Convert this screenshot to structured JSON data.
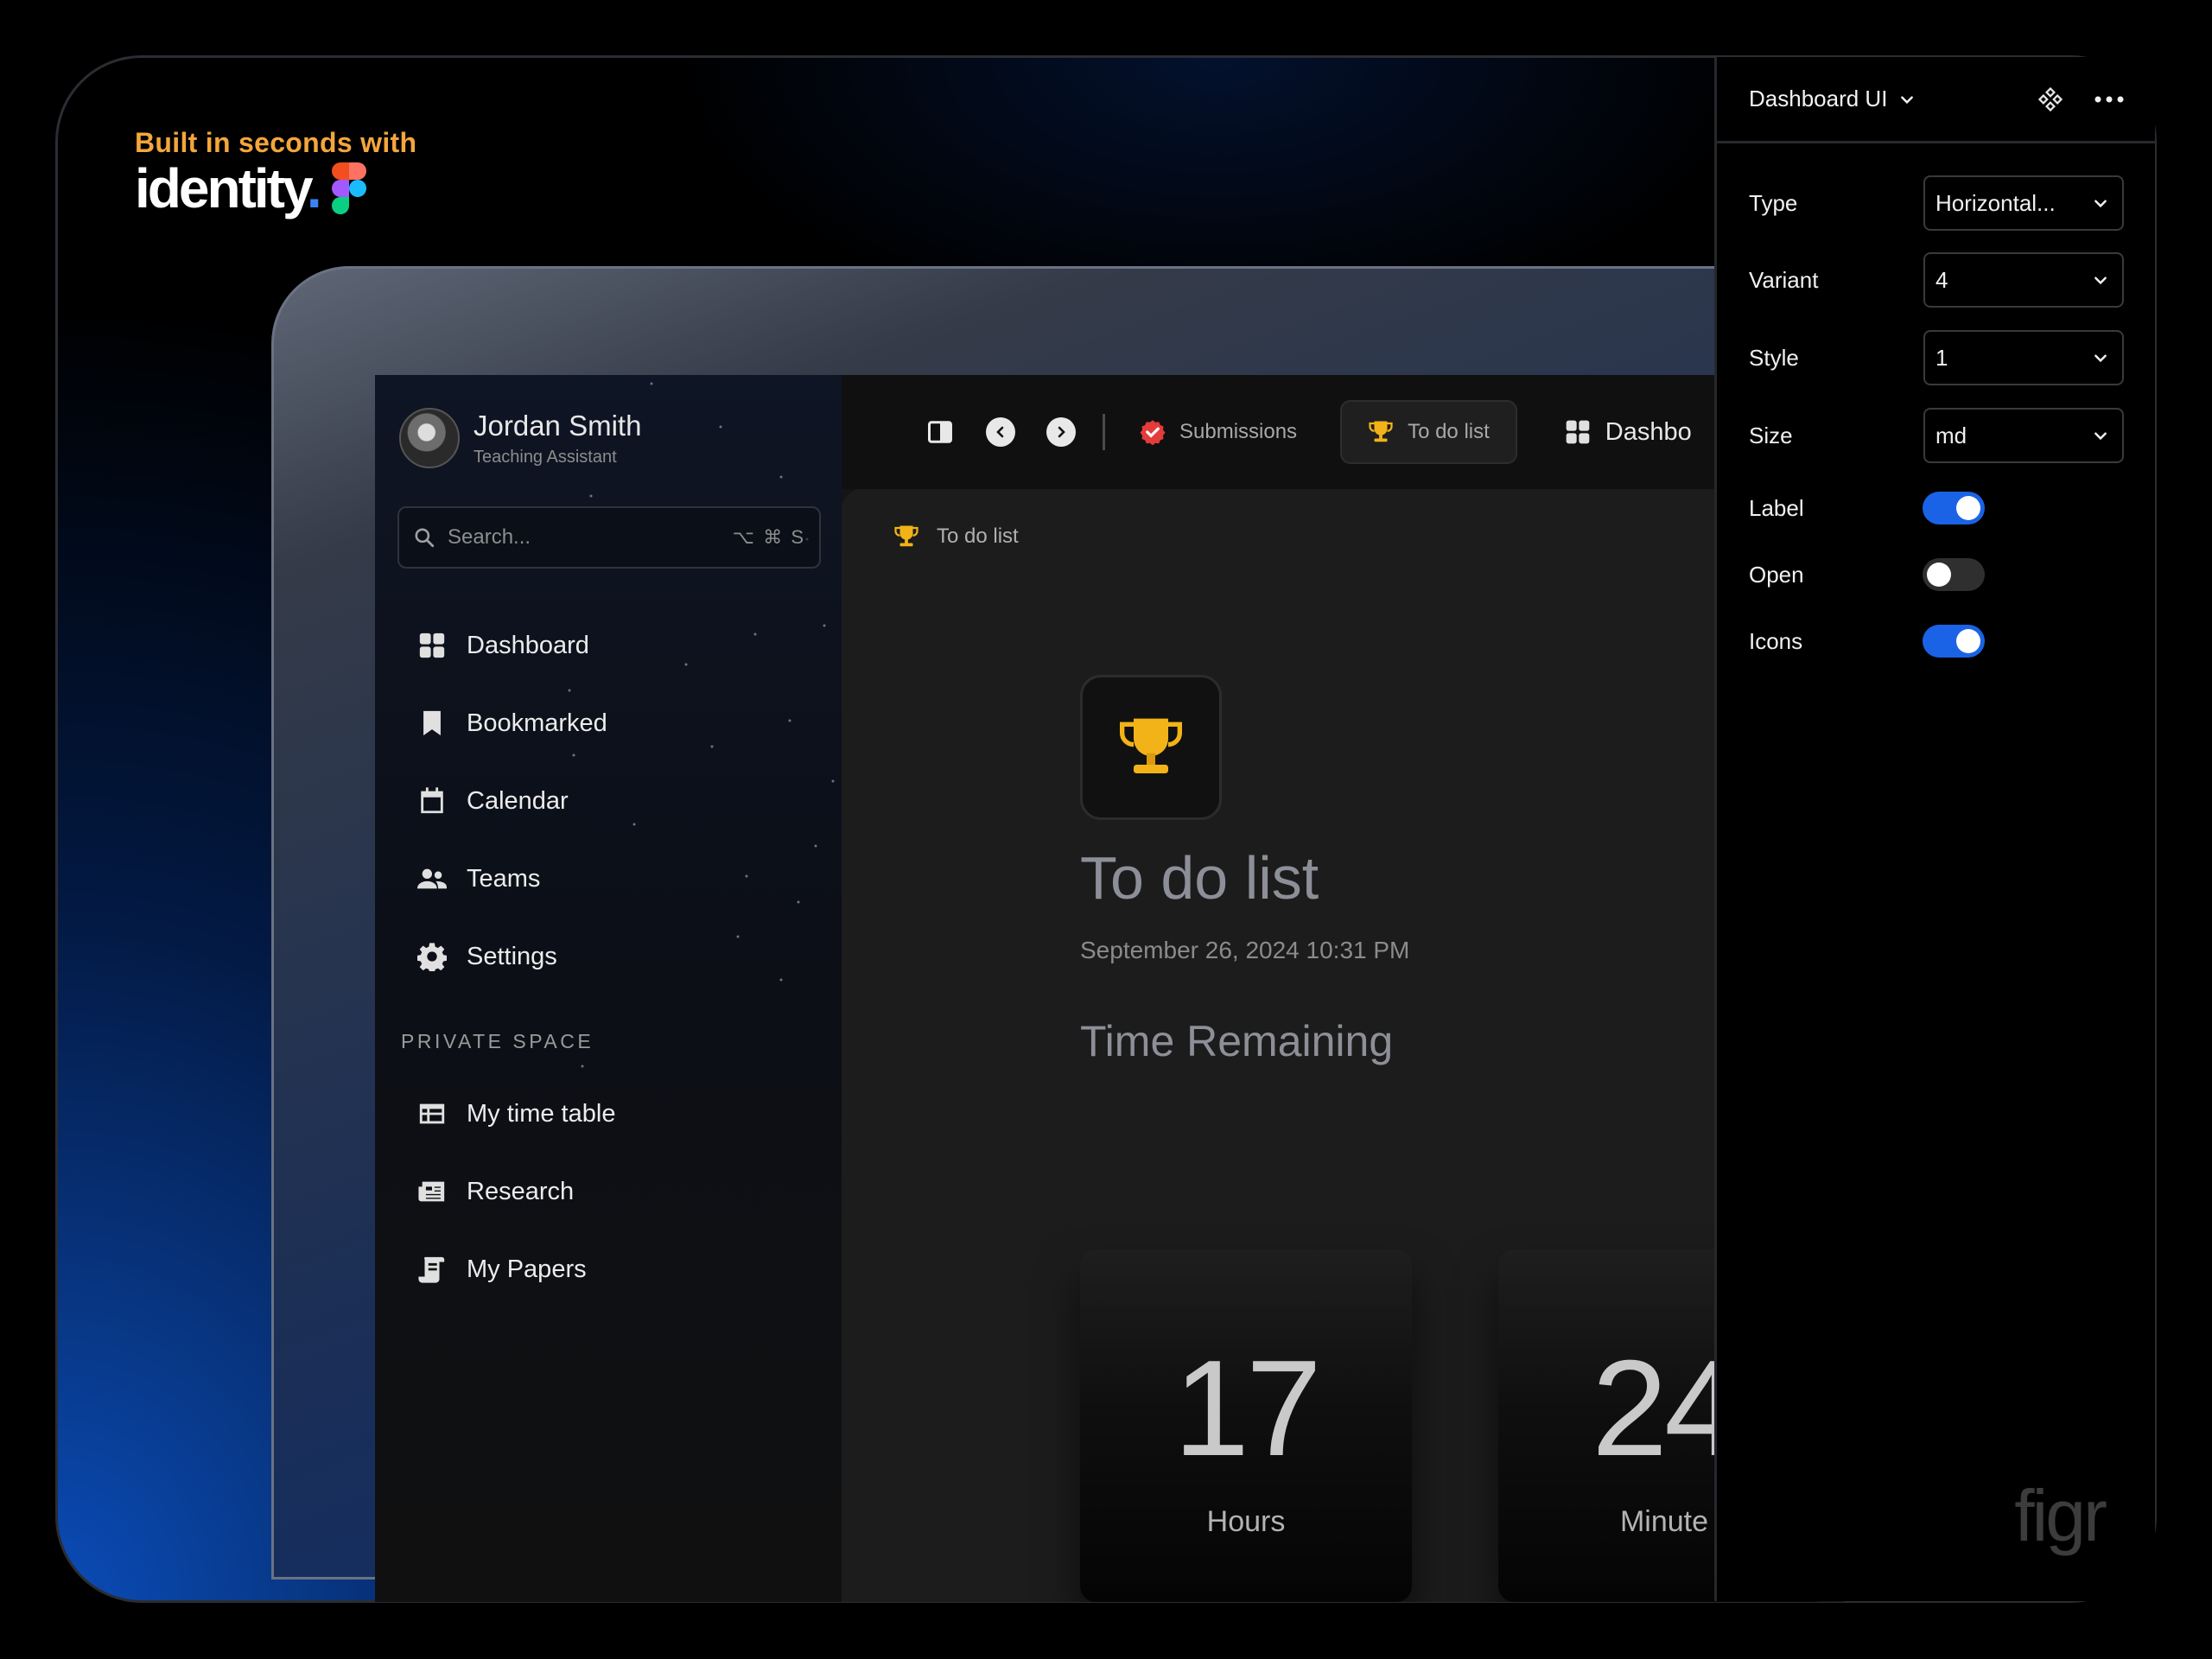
{
  "brand": {
    "tagline": "Built in seconds with",
    "logo_text": "identity",
    "logo_dot": "."
  },
  "profile": {
    "name": "Jordan Smith",
    "role": "Teaching Assistant"
  },
  "search": {
    "placeholder": "Search...",
    "shortcut": "⌥ ⌘ S"
  },
  "nav": {
    "items": [
      {
        "label": "Dashboard",
        "icon": "grid-icon"
      },
      {
        "label": "Bookmarked",
        "icon": "bookmark-icon"
      },
      {
        "label": "Calendar",
        "icon": "calendar-icon"
      },
      {
        "label": "Teams",
        "icon": "people-icon"
      },
      {
        "label": "Settings",
        "icon": "gear-icon"
      }
    ],
    "section_label": "PRIVATE SPACE",
    "private_items": [
      {
        "label": "My time table",
        "icon": "table-icon"
      },
      {
        "label": "Research",
        "icon": "newspaper-icon"
      },
      {
        "label": "My Papers",
        "icon": "scroll-icon"
      }
    ]
  },
  "topbar": {
    "tabs": [
      {
        "label": "Submissions",
        "icon": "check-badge-icon"
      },
      {
        "label": "To do list",
        "icon": "trophy-icon",
        "active": true
      },
      {
        "label": "Dashbo",
        "icon": "grid-icon"
      }
    ]
  },
  "content": {
    "breadcrumb": "To do list",
    "title": "To do list",
    "date": "September 26, 2024 10:31 PM",
    "remaining_label": "Time Remaining",
    "timers": [
      {
        "value": "17",
        "unit": "Hours"
      },
      {
        "value": "24",
        "unit": "Minute"
      }
    ]
  },
  "panel": {
    "title": "Dashboard UI",
    "props": [
      {
        "label": "Type",
        "value": "Horizontal..."
      },
      {
        "label": "Variant",
        "value": "4"
      },
      {
        "label": "Style",
        "value": "1"
      },
      {
        "label": "Size",
        "value": "md"
      }
    ],
    "toggles": [
      {
        "label": "Label",
        "on": true
      },
      {
        "label": "Open",
        "on": false
      },
      {
        "label": "Icons",
        "on": true
      }
    ]
  },
  "watermark": "figr",
  "colors": {
    "accent": "#1a63e6",
    "brand_orange": "#f4a63c",
    "trophy": "#f2b318",
    "check_red": "#e43b3b"
  }
}
